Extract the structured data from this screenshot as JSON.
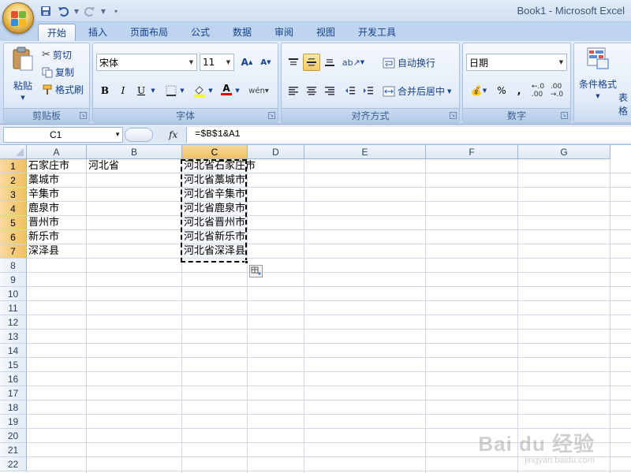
{
  "window": {
    "title": "Book1 - Microsoft Excel"
  },
  "tabs": [
    {
      "label": "开始",
      "active": true
    },
    {
      "label": "插入"
    },
    {
      "label": "页面布局"
    },
    {
      "label": "公式"
    },
    {
      "label": "数据"
    },
    {
      "label": "审阅"
    },
    {
      "label": "视图"
    },
    {
      "label": "开发工具"
    }
  ],
  "ribbon": {
    "clipboard": {
      "label": "剪贴板",
      "paste": "粘贴",
      "cut": "剪切",
      "copy": "复制",
      "format_painter": "格式刷"
    },
    "font": {
      "label": "字体",
      "name": "宋体",
      "size": "11"
    },
    "alignment": {
      "label": "对齐方式",
      "wrap_text": "自动换行",
      "merge_center": "合并后居中"
    },
    "number": {
      "label": "数字",
      "format": "日期"
    },
    "styles": {
      "conditional_format": "条件格式",
      "table_partial": "表格"
    }
  },
  "formula_bar": {
    "name_box": "C1",
    "fx": "fx",
    "formula": "=$B$1&A1"
  },
  "grid": {
    "columns": [
      "A",
      "B",
      "C",
      "D",
      "E",
      "F",
      "G"
    ],
    "selected_column": "C",
    "rows": [
      "1",
      "2",
      "3",
      "4",
      "5",
      "6",
      "7",
      "8",
      "9",
      "10",
      "11",
      "12",
      "13",
      "14",
      "15",
      "16",
      "17",
      "18",
      "19",
      "20",
      "21",
      "22"
    ],
    "selected_rows": [
      "1",
      "2",
      "3",
      "4",
      "5",
      "6",
      "7"
    ],
    "cells": {
      "A1": "石家庄市",
      "A2": "藁城市",
      "A3": "辛集市",
      "A4": "鹿泉市",
      "A5": "晋州市",
      "A6": "新乐市",
      "A7": "深泽县",
      "B1": "河北省",
      "C1": "河北省石家庄市",
      "C2": "河北省藁城市",
      "C3": "河北省辛集市",
      "C4": "河北省鹿泉市",
      "C5": "河北省晋州市",
      "C6": "河北省新乐市",
      "C7": "河北省深泽县"
    }
  },
  "watermark": {
    "main": "Bai du 经验",
    "sub": "jingyan.baidu.com"
  },
  "colors": {
    "ribbon_bg": "#dbe7f7",
    "selection_header": "#f6ca72",
    "text_blue": "#15428b",
    "gridline": "#d0d7e5"
  }
}
